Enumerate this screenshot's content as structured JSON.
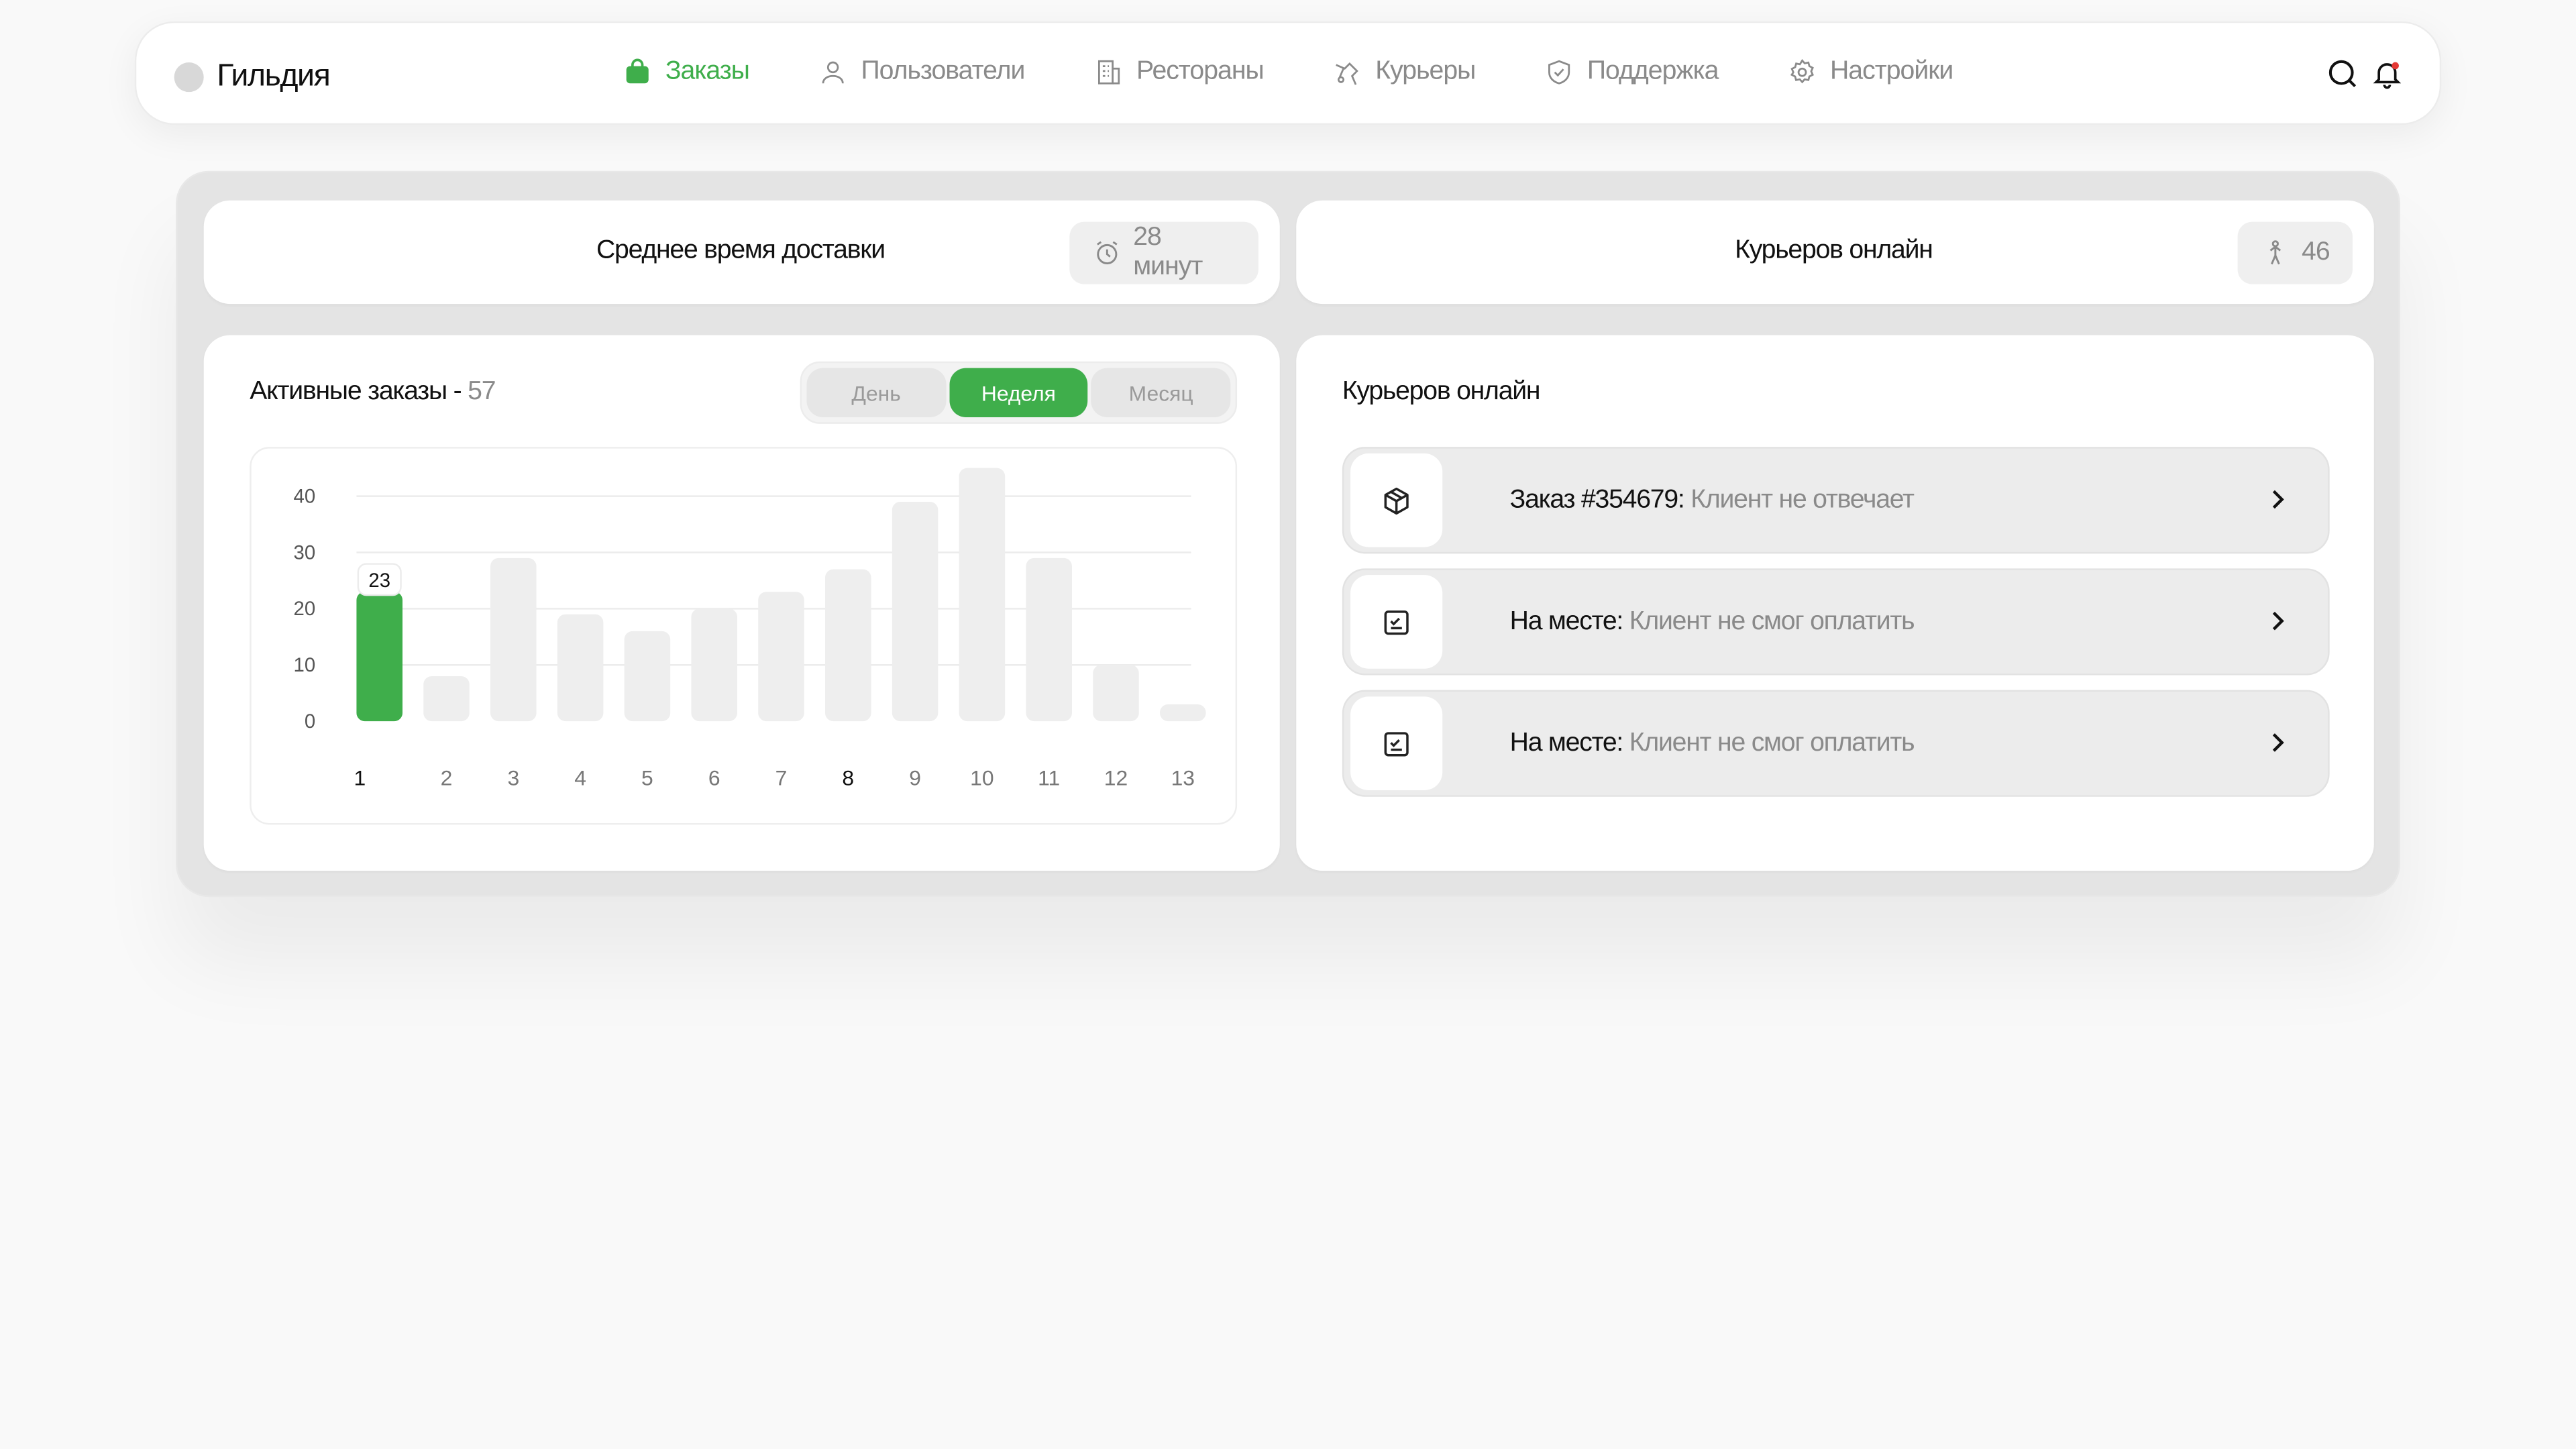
{
  "app": {
    "name": "Гильдия"
  },
  "nav": {
    "items": [
      {
        "label": "Заказы",
        "icon": "bag-icon",
        "active": true
      },
      {
        "label": "Пользователи",
        "icon": "user-icon",
        "active": false
      },
      {
        "label": "Рестораны",
        "icon": "building-icon",
        "active": false
      },
      {
        "label": "Курьеры",
        "icon": "courier-icon",
        "active": false
      },
      {
        "label": "Поддержка",
        "icon": "shield-check-icon",
        "active": false
      },
      {
        "label": "Настройки",
        "icon": "gear-icon",
        "active": false
      }
    ],
    "right_icons": [
      "search-icon",
      "bell-icon"
    ]
  },
  "stats": {
    "delivery": {
      "label": "Среднее время доставки",
      "value": "28 минут",
      "icon": "alarm-clock-icon"
    },
    "couriers": {
      "label": "Курьеров онлайн",
      "value": "46",
      "icon": "walking-person-icon"
    }
  },
  "orders": {
    "title": "Активные заказы - ",
    "count": "57",
    "periods": [
      {
        "label": "День",
        "active": false
      },
      {
        "label": "Неделя",
        "active": true
      },
      {
        "label": "Месяц",
        "active": false
      }
    ]
  },
  "chart_data": {
    "type": "bar",
    "title": "",
    "xlabel": "",
    "ylabel": "",
    "categories": [
      "1",
      "2",
      "3",
      "4",
      "5",
      "6",
      "7",
      "8",
      "9",
      "10",
      "11",
      "12",
      "13"
    ],
    "values": [
      23,
      8,
      29,
      19,
      16,
      20,
      23,
      27,
      39,
      45,
      29,
      10,
      3
    ],
    "highlighted_index": 0,
    "highlighted_label": "23",
    "bold_category_index": 7,
    "ylim": [
      0,
      40
    ],
    "yticks": [
      "0",
      "10",
      "20",
      "30",
      "40"
    ],
    "grid": true,
    "colors": {
      "highlight": "#3fae4b",
      "bar": "#eeeeee",
      "grid": "#ececec"
    }
  },
  "alerts": {
    "title": "Курьеров онлайн",
    "items": [
      {
        "strong": "Заказ #354679:",
        "text": " Клиент не отвечает",
        "icon": "box-icon"
      },
      {
        "strong": "На месте:",
        "text": " Клиент не смог оплатить",
        "icon": "checklist-icon"
      },
      {
        "strong": "На месте:",
        "text": " Клиент не смог оплатить",
        "icon": "checklist-icon"
      }
    ]
  },
  "colors": {
    "accent": "#3fae4b",
    "muted_text": "#8a8a8a",
    "panel": "#e4e4e4"
  }
}
